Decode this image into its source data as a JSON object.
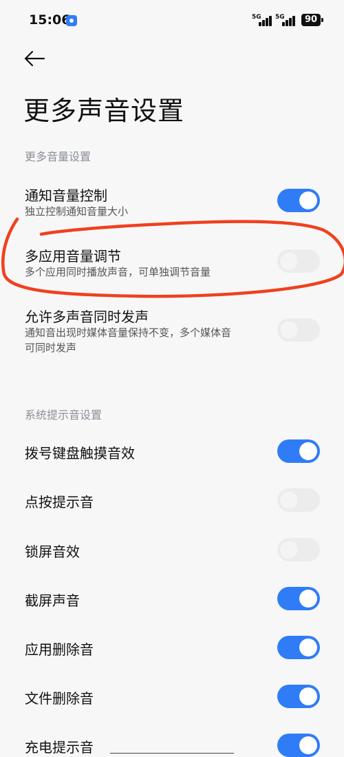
{
  "status_bar": {
    "time": "15:06",
    "signal_1": "5G",
    "signal_2": "5G",
    "battery": "90"
  },
  "page_title": "更多声音设置",
  "sections": [
    {
      "header": "更多音量设置",
      "items": [
        {
          "title": "通知音量控制",
          "subtitle": "独立控制通知音量大小",
          "enabled": true
        },
        {
          "title": "多应用音量调节",
          "subtitle": "多个应用同时播放声音，可单独调节音量",
          "enabled": false
        },
        {
          "title": "允许多声音同时发声",
          "subtitle_line1": "通知音出现时媒体音量保持不变，多个媒体音",
          "subtitle_line2": "可同时发声",
          "enabled": false
        }
      ]
    },
    {
      "header": "系统提示音设置",
      "items": [
        {
          "title": "拨号键盘触摸音效",
          "enabled": true
        },
        {
          "title": "点按提示音",
          "enabled": false
        },
        {
          "title": "锁屏音效",
          "enabled": false
        },
        {
          "title": "截屏声音",
          "enabled": true
        },
        {
          "title": "应用删除音",
          "enabled": true
        },
        {
          "title": "文件删除音",
          "enabled": true
        },
        {
          "title": "充电提示音",
          "enabled": true
        }
      ]
    }
  ],
  "colors": {
    "accent": "#2f7cf6",
    "annotation": "#f0401e",
    "background": "#f7f7f7"
  }
}
